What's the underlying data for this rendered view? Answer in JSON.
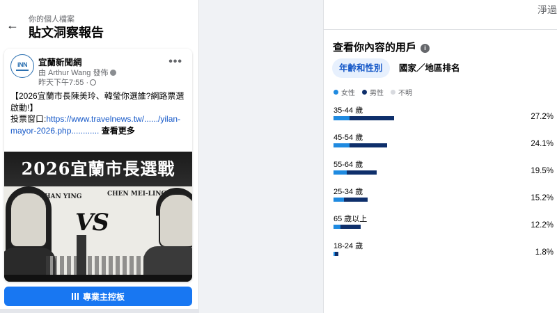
{
  "left": {
    "kicker": "你的個人檔案",
    "title": "貼文洞察報告",
    "post": {
      "avatar_text": "iNN",
      "page_name": "宜蘭新聞網",
      "byline": "由 Arthur Wang 發佈",
      "time": "昨天下午7:55 ·",
      "text_line1": "【2026宜蘭市長陳美玲、韓瑩你選誰?網路票選啟動!】",
      "text_line2": "投票窗口:",
      "link": "https://www.travelnews.tw/....../yilan-mayor-2026.php............",
      "see_more": " 查看更多",
      "image_headline": "2026宜蘭市長選戰",
      "image_name_left": "HAN YING",
      "image_name_right": "CHEN MEI-LING",
      "image_vs": "VS"
    },
    "dashboard_button": "專業主控板"
  },
  "right": {
    "top_cut_text": "淨過",
    "title": "查看你內容的用戶",
    "tabs": [
      {
        "label": "年齡和性別",
        "active": true
      },
      {
        "label": "國家／地區排名",
        "active": false
      }
    ],
    "legend": [
      {
        "label": "女性",
        "color": "#1f8ae0"
      },
      {
        "label": "男性",
        "color": "#0e2f6b"
      },
      {
        "label": "不明",
        "color": "#d8dadf"
      }
    ],
    "rows": [
      {
        "label": "35-44 歲",
        "pct": "27.2%",
        "female": 0.072,
        "male": 0.2
      },
      {
        "label": "45-54 歲",
        "pct": "24.1%",
        "female": 0.072,
        "male": 0.169
      },
      {
        "label": "55-64 歲",
        "pct": "19.5%",
        "female": 0.06,
        "male": 0.135
      },
      {
        "label": "25-34 歲",
        "pct": "15.2%",
        "female": 0.048,
        "male": 0.104
      },
      {
        "label": "65 歲以上",
        "pct": "12.2%",
        "female": 0.032,
        "male": 0.09
      },
      {
        "label": "18-24 歲",
        "pct": "1.8%",
        "female": 0.003,
        "male": 0.015
      }
    ]
  }
}
